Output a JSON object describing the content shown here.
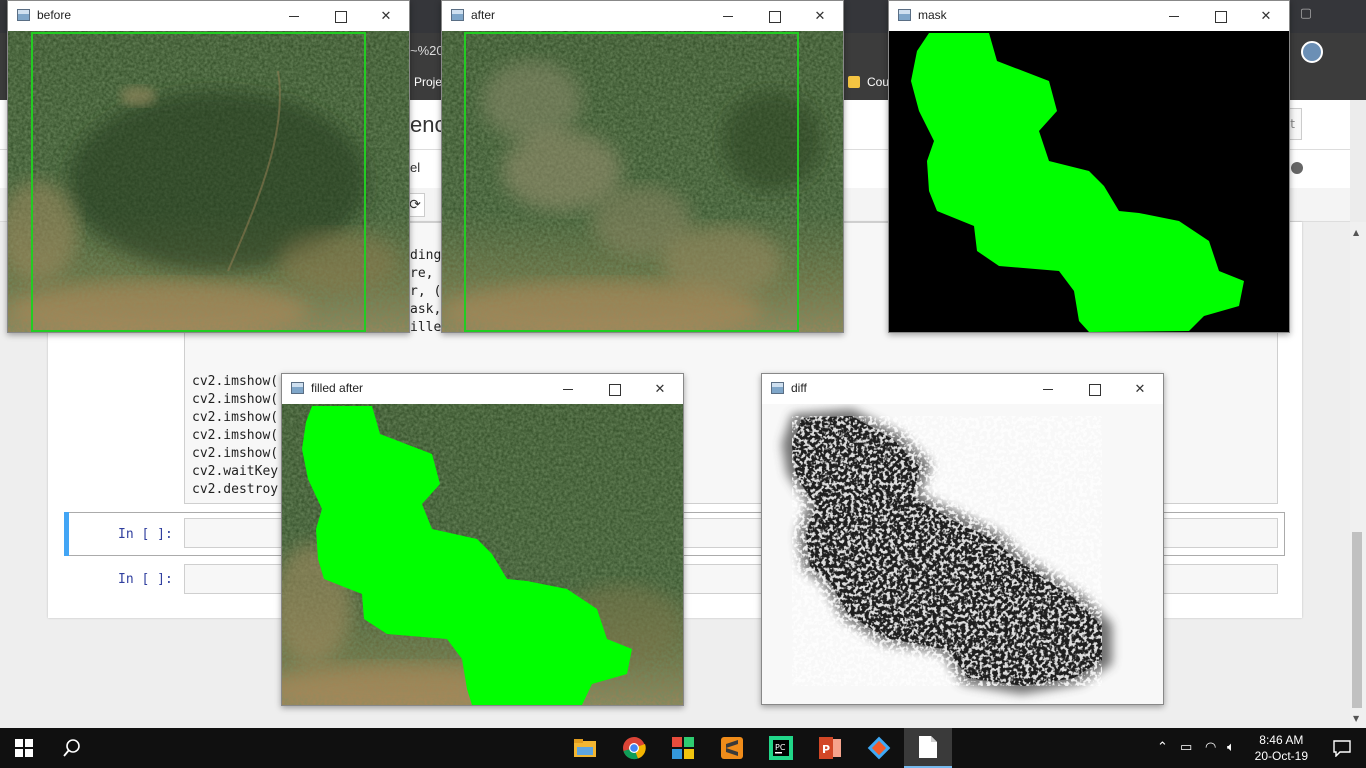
{
  "browser": {
    "url_fragment": "~%20",
    "bookmarks": [
      "Proje",
      "Cou"
    ]
  },
  "notebook": {
    "title_fragment": "ence",
    "menu_fragment": "el",
    "logout_fragment": "t",
    "code_fragments": [
      "ding",
      "re, (",
      "r, (",
      "ask,",
      "ille"
    ],
    "code_lines": [
      "cv2.imshow(",
      "cv2.imshow(",
      "cv2.imshow(",
      "cv2.imshow(",
      "cv2.imshow(",
      "cv2.waitKey",
      "cv2.destroy"
    ],
    "cells": [
      {
        "prompt": "In [ ]:"
      },
      {
        "prompt": "In [ ]:"
      }
    ]
  },
  "windows": {
    "before": {
      "title": "before"
    },
    "after": {
      "title": "after"
    },
    "mask": {
      "title": "mask"
    },
    "filled_after": {
      "title": "filled after"
    },
    "diff": {
      "title": "diff"
    }
  },
  "colors": {
    "mask_green": "#00ff00",
    "roi_rectangle": "#22cc22",
    "forest": "#2c4220",
    "accent": "#42a5f5"
  },
  "taskbar": {
    "apps": [
      "windows-start-icon",
      "search-icon",
      "file-explorer-icon",
      "chrome-icon",
      "office-icon",
      "sublime-text-icon",
      "pycharm-icon",
      "powerpoint-icon",
      "git-icon",
      "notepad-icon"
    ],
    "time": "8:46 AM",
    "date": "20-Oct-19"
  }
}
